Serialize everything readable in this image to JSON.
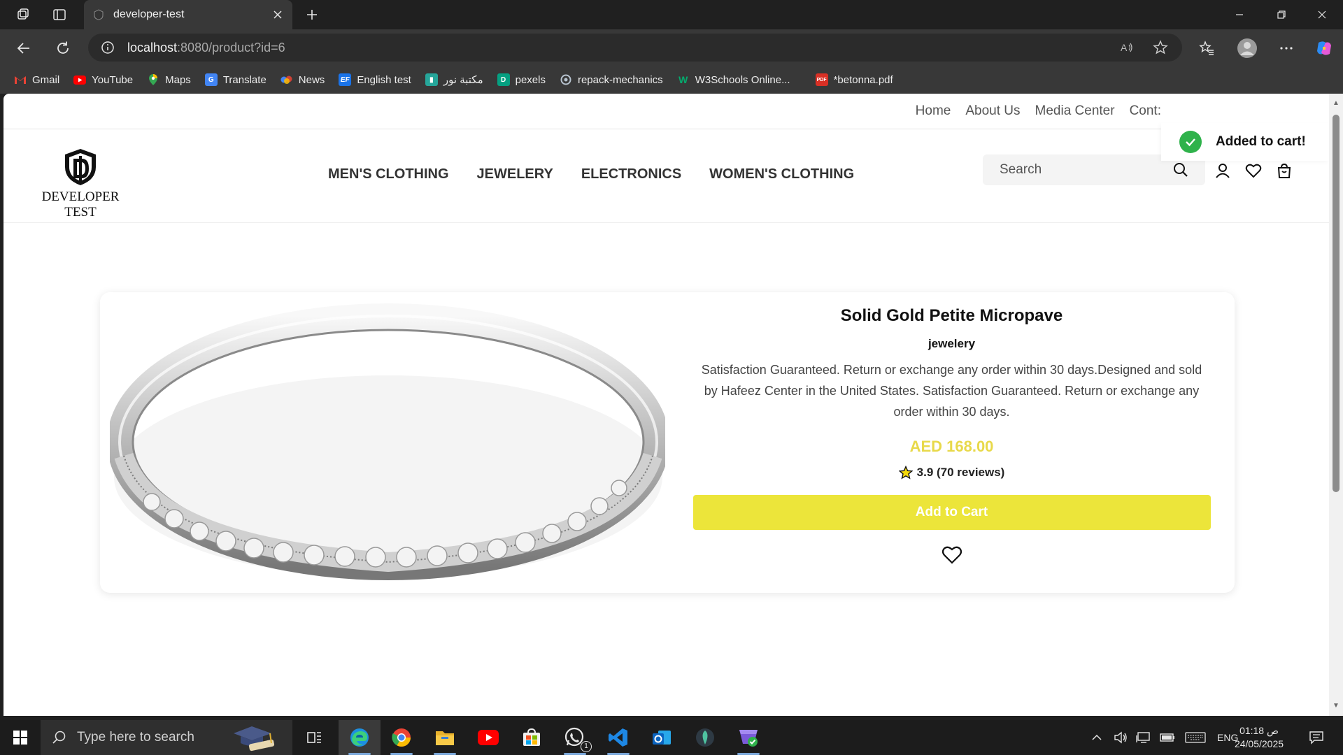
{
  "browser": {
    "tab_title": "developer-test",
    "url_host": "localhost",
    "url_path": ":8080/product?id=6"
  },
  "bookmarks": [
    {
      "label": "Gmail",
      "icon": "gmail-icon",
      "color": "#ea4335"
    },
    {
      "label": "YouTube",
      "icon": "youtube-icon",
      "color": "#ff0000"
    },
    {
      "label": "Maps",
      "icon": "maps-icon",
      "color": "#34a853"
    },
    {
      "label": "Translate",
      "icon": "translate-icon",
      "color": "#4285f4"
    },
    {
      "label": "News",
      "icon": "news-icon",
      "color": "#4285f4"
    },
    {
      "label": "English test",
      "icon": "ef-icon",
      "color": "#1a73e8"
    },
    {
      "label": "مكتبة نور",
      "icon": "library-icon",
      "color": "#26a69a"
    },
    {
      "label": "pexels",
      "icon": "pexels-icon",
      "color": "#05a081"
    },
    {
      "label": "repack-mechanics",
      "icon": "repack-icon",
      "color": "#6e7c8c"
    },
    {
      "label": "W3Schools Online...",
      "icon": "w3schools-icon",
      "color": "#04aa6d"
    },
    {
      "label": "*betonna.pdf",
      "icon": "pdf-icon",
      "color": "#d93025"
    }
  ],
  "site": {
    "top_links": [
      "Home",
      "About Us",
      "Media Center",
      "Cont:"
    ],
    "logo_text": "DEVELOPER TEST",
    "nav": [
      "MEN'S CLOTHING",
      "JEWELERY",
      "ELECTRONICS",
      "WOMEN'S CLOTHING"
    ],
    "search_placeholder": "Search",
    "toast": "Added to cart!"
  },
  "product": {
    "title": "Solid Gold Petite Micropave",
    "category": "jewelery",
    "description": "Satisfaction Guaranteed. Return or exchange any order within 30 days.Designed and sold by Hafeez Center in the United States. Satisfaction Guaranteed. Return or exchange any order within 30 days.",
    "price": "AED 168.00",
    "rating": "3.9 (70 reviews)",
    "add_to_cart": "Add to Cart",
    "accent_color": "#ece53a"
  },
  "taskbar": {
    "search_placeholder": "Type here to search",
    "language": "ENG",
    "time": "01:18 ص",
    "date": "24/05/2025",
    "whatsapp_badge": "1"
  }
}
